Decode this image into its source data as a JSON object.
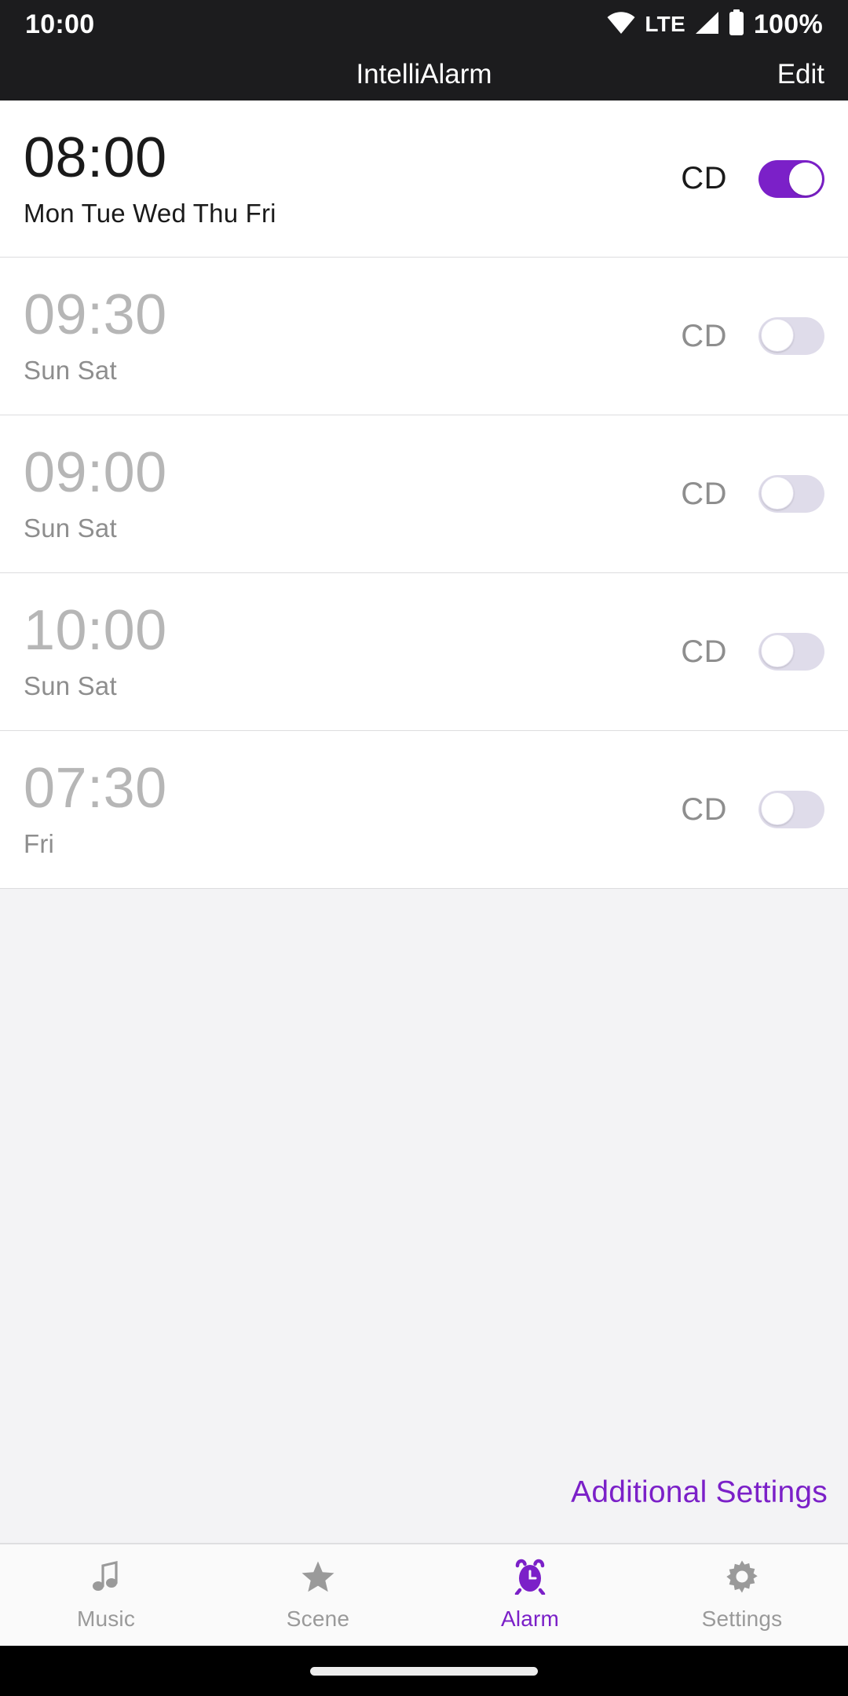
{
  "status_bar": {
    "clock": "10:00",
    "network_label": "LTE",
    "battery_label": "100%",
    "wifi_icon": "wifi-icon",
    "signal_icon": "signal-icon",
    "battery_icon": "battery-icon"
  },
  "app_bar": {
    "title": "IntelliAlarm",
    "edit_label": "Edit"
  },
  "theme": {
    "accent": "#7B20C8",
    "toggle_on_track": "#7B20C8",
    "toggle_off_track": "#DFDCEA",
    "appbar_bg": "#1C1C1E",
    "filler_bg": "#F3F3F5",
    "divider": "#DDDDDE"
  },
  "alarms": [
    {
      "time": "08:00",
      "days": "Mon Tue Wed Thu Fri",
      "tag": "CD",
      "enabled": true
    },
    {
      "time": "09:30",
      "days": "Sun Sat",
      "tag": "CD",
      "enabled": false
    },
    {
      "time": "09:00",
      "days": "Sun Sat",
      "tag": "CD",
      "enabled": false
    },
    {
      "time": "10:00",
      "days": "Sun Sat",
      "tag": "CD",
      "enabled": false
    },
    {
      "time": "07:30",
      "days": "Fri",
      "tag": "CD",
      "enabled": false
    }
  ],
  "footer": {
    "additional_settings_label": "Additional Settings"
  },
  "bottom_nav": {
    "items": [
      {
        "label": "Music",
        "icon": "music-note-icon",
        "active": false
      },
      {
        "label": "Scene",
        "icon": "star-icon",
        "active": false
      },
      {
        "label": "Alarm",
        "icon": "alarm-clock-icon",
        "active": true
      },
      {
        "label": "Settings",
        "icon": "gear-icon",
        "active": false
      }
    ]
  }
}
